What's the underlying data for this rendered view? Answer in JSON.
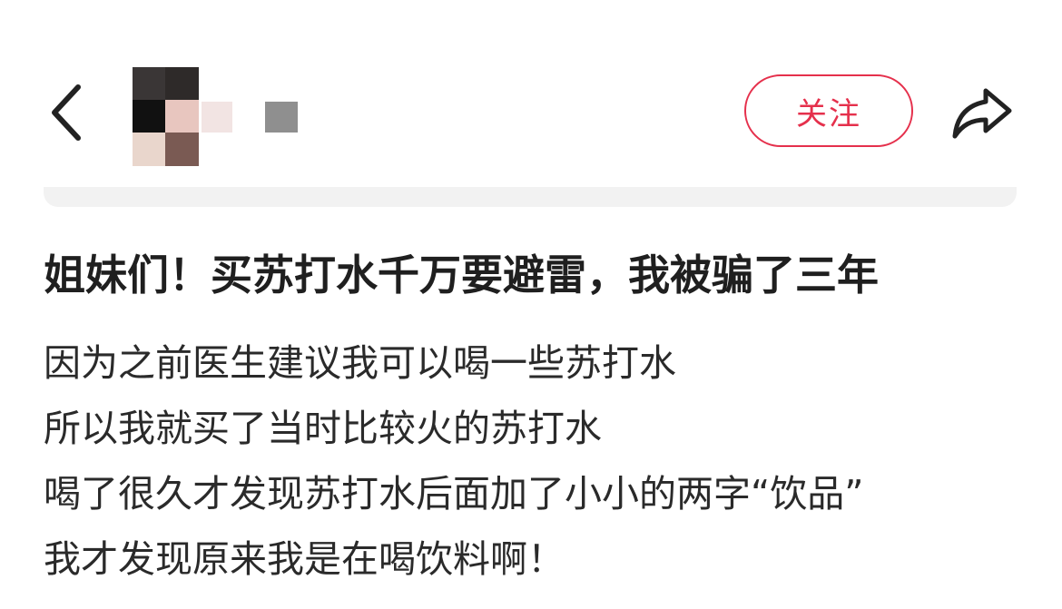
{
  "header": {
    "back_icon": "chevron-left-icon",
    "follow_label": "关注",
    "share_icon": "share-arrow-icon",
    "accent_color": "#e5304c"
  },
  "post": {
    "title": "姐妹们！买苏打水千万要避雷，我被骗了三年",
    "lines": [
      "因为之前医生建议我可以喝一些苏打水",
      "所以我就买了当时比较火的苏打水",
      "喝了很久才发现苏打水后面加了小小的两字“饮品”",
      "我才发现原来我是在喝饮料啊！"
    ]
  }
}
